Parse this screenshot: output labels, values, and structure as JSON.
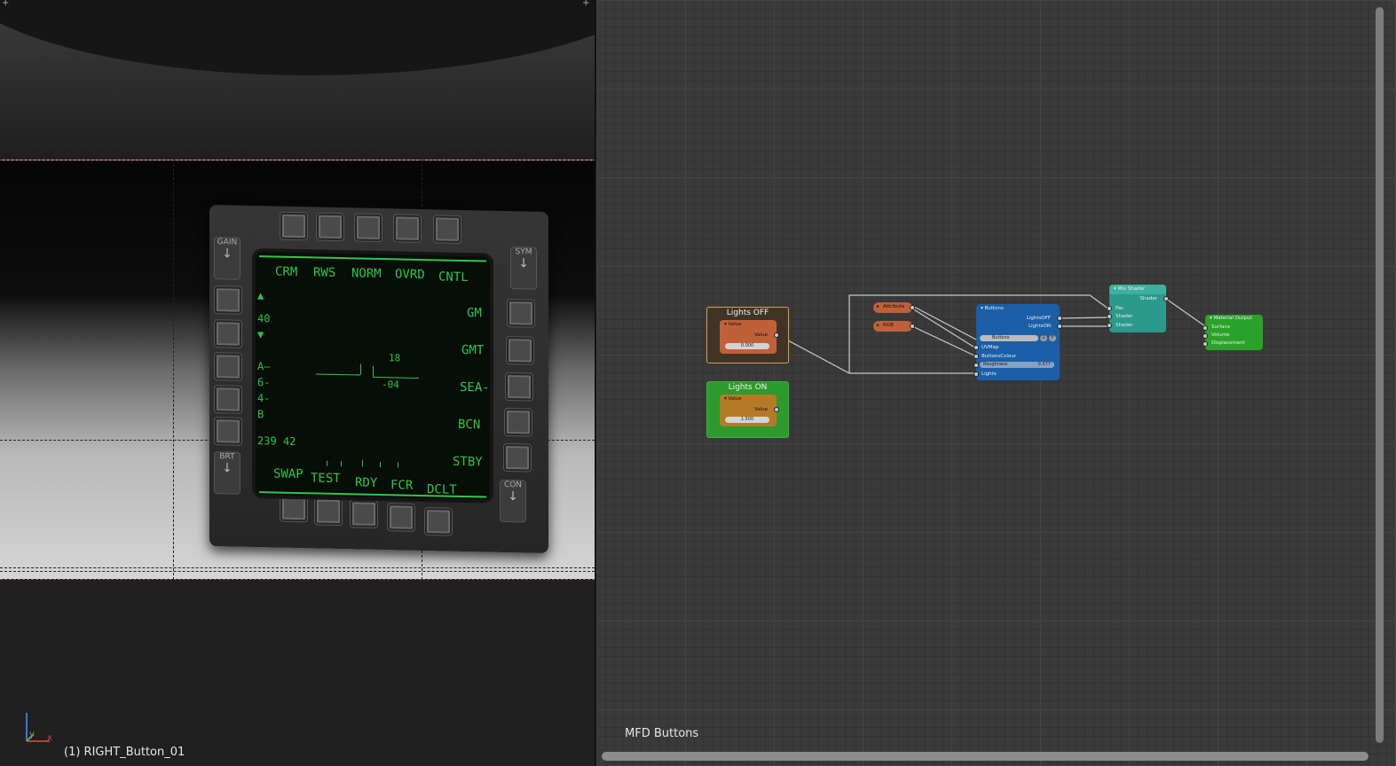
{
  "viewport": {
    "object_label": "(1) RIGHT_Button_01",
    "axis_labels": {
      "x": "x",
      "y": "y"
    }
  },
  "mfd": {
    "top_labels": [
      "CRM",
      "RWS",
      "NORM",
      "OVRD",
      "CNTL"
    ],
    "right_labels": [
      "GM",
      "GMT",
      "SEA-",
      "BCN",
      "STBY"
    ],
    "bottom_labels": [
      "SWAP",
      "TEST",
      "RDY",
      "FCR",
      "DCLT"
    ],
    "left_scale": [
      "40",
      "A—",
      "6-",
      "4-",
      "B"
    ],
    "bottom_left": "239 42",
    "center_top": "18",
    "center_bottom": "-04",
    "rocker_labels": [
      "GAIN",
      "SYM",
      "BRT",
      "CON"
    ]
  },
  "node_editor": {
    "name": "MFD Buttons",
    "frames": {
      "lights_off": "Lights OFF",
      "lights_on": "Lights ON"
    },
    "value_off": {
      "header": "Value",
      "output": "Value",
      "field": "0.000"
    },
    "value_on": {
      "header": "Value",
      "output": "Value",
      "field": "1.500"
    },
    "attribute": "Attribute",
    "rgb": "RGB",
    "group": {
      "header": "Buttons",
      "outputs": [
        "LightsOFF",
        "LightsON"
      ],
      "datablock": "Buttons",
      "users": "2",
      "inputs": [
        "UVMap",
        "ButtonsColour"
      ],
      "roughness_label": "Roughness",
      "roughness_value": "0.577",
      "lights": "Lights"
    },
    "mix": {
      "header": "Mix Shader",
      "output": "Shader",
      "inputs": [
        "Fac",
        "Shader",
        "Shader"
      ]
    },
    "output": {
      "header": "Material Output",
      "inputs": [
        "Surface",
        "Volume",
        "Displacement"
      ]
    }
  },
  "colors": {
    "mfd_green": "#2fc64a",
    "value_node": "#c0603a",
    "value_node_on": "#b57a28",
    "group_node": "#1a5fa8",
    "mix_node": "#2b9a8c",
    "output_node": "#2aa22a",
    "frame_on": "#2d9a2d"
  }
}
